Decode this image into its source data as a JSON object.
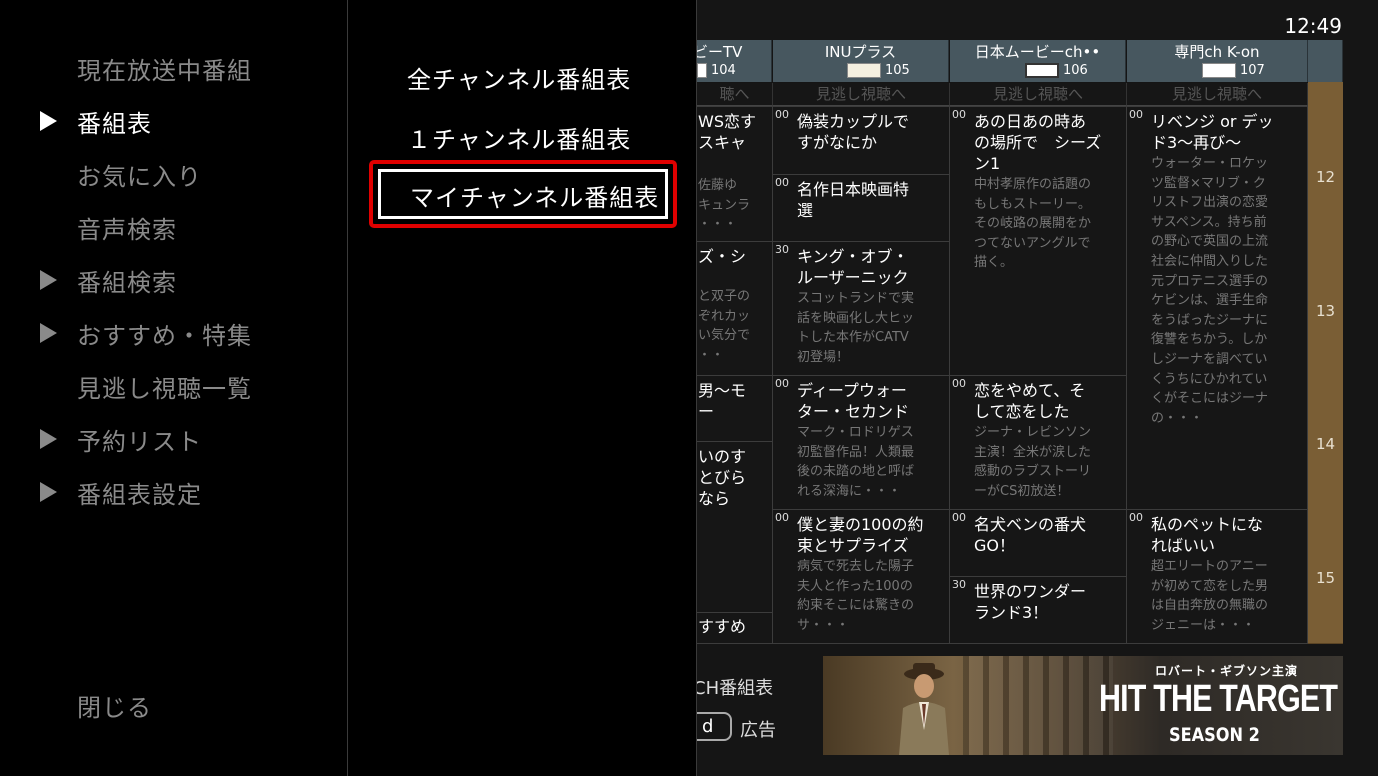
{
  "menu": {
    "items": [
      {
        "label": "現在放送中番組",
        "arrow": false,
        "active": false
      },
      {
        "label": "番組表",
        "arrow": true,
        "active": true
      },
      {
        "label": "お気に入り",
        "arrow": false,
        "active": false
      },
      {
        "label": "音声検索",
        "arrow": false,
        "active": false
      },
      {
        "label": "番組検索",
        "arrow": true,
        "active": false
      },
      {
        "label": "おすすめ・特集",
        "arrow": true,
        "active": false
      },
      {
        "label": "見逃し視聴一覧",
        "arrow": false,
        "active": false
      },
      {
        "label": "予約リスト",
        "arrow": true,
        "active": false
      },
      {
        "label": "番組表設定",
        "arrow": true,
        "active": false
      }
    ],
    "close_label": "閉じる"
  },
  "submenu": {
    "items": [
      "全チャンネル番組表",
      "１チャンネル番組表",
      "マイチャンネル番組表"
    ],
    "focused_index": 2
  },
  "clock": "12:49",
  "channels": [
    {
      "name": "ビーTV",
      "number": "104"
    },
    {
      "name": "INUプラス",
      "number": "105"
    },
    {
      "name": "日本ムービーch••",
      "number": "106"
    },
    {
      "name": "専門ch K-on",
      "number": "107"
    }
  ],
  "missed_label": "見逃し視聴へ",
  "partial_missed_label": "聴へ",
  "programs": {
    "col0": [
      {
        "title": "WS恋す\nスキャ",
        "desc": "佐藤ゆ\nキュンラ\n・・・"
      },
      {
        "title": "ズ・シ",
        "desc": "と双子の\nぞれカッ\nい気分で\n・・"
      },
      {
        "title": "男～モ\nー",
        "desc": ""
      },
      {
        "title": "いのす\nとびら\nなら",
        "desc": ""
      },
      {
        "title": "すすめ",
        "desc": ""
      }
    ],
    "col1": [
      {
        "min": "00",
        "title": "偽装カップルで\nすがなにか",
        "desc": ""
      },
      {
        "min": "00",
        "title": "名作日本映画特\n選",
        "desc": ""
      },
      {
        "min": "30",
        "title": "キング・オブ・\nルーザーニック",
        "desc": "スコットランドで実\n話を映画化し大ヒッ\nトした本作がCATV\n初登場！"
      },
      {
        "min": "00",
        "title": "ディープウォー\nター・セカンド",
        "desc": "マーク・ロドリゲス\n初監督作品！人類最\n後の未踏の地と呼ば\nれる深海に・・・"
      },
      {
        "min": "00",
        "title": "僕と妻の100の約\n束とサプライズ",
        "desc": "病気で死去した陽子\n夫人と作った100の\n約束そこには驚きの\nサ・・・"
      }
    ],
    "col2": [
      {
        "min": "00",
        "title": "あの日あの時あ\nの場所で　シーズ\nン1",
        "desc": "中村孝原作の話題の\nもしもストーリー。\nその岐路の展開をか\nつてないアングルで\n描く。"
      },
      {
        "min": "00",
        "title": "恋をやめて、そ\nして恋をした",
        "desc": "ジーナ・レビンソン\n主演！全米が涙した\n感動のラブストーリ\nーがCS初放送！"
      },
      {
        "min": "00",
        "title": "名犬ベンの番犬\nGO！",
        "desc": ""
      },
      {
        "min": "30",
        "title": "世界のワンダー\nランド3！",
        "desc": ""
      }
    ],
    "col3": [
      {
        "min": "00",
        "title": "リベンジ or デッ\nド3～再び～",
        "desc": "ウォーター・ロケッ\nツ監督×マリブ・ク\nリストフ出演の恋愛\nサスペンス。持ち前\nの野心で英国の上流\n社会に仲間入りした\n元プロテニス選手の\nケビンは、選手生命\nをうばったジーナに\n復讐をちかう。しか\nしジーナを調べてい\nくうちにひかれてい\nくがそこにはジーナ\nの・・・"
      },
      {
        "min": "00",
        "title": "私のペットにな\nればいい",
        "desc": "超エリートのアニー\nが初めて恋をした男\nは自由奔放の無職の\nジェニーは・・・"
      }
    ]
  },
  "hours": [
    "12",
    "13",
    "14",
    "15"
  ],
  "footer": {
    "ch_label": "CH番組表",
    "d_button": "d",
    "ad_label": "広告"
  },
  "ad": {
    "tagline": "ロバート・ギブソン主演",
    "title": "HIT THE TARGET",
    "season": "SEASON 2"
  }
}
